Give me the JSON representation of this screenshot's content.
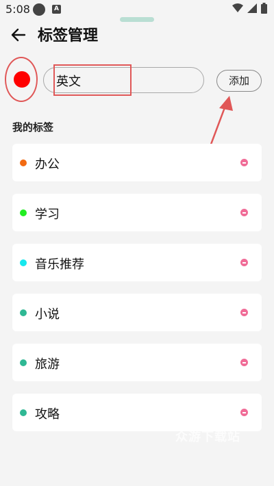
{
  "status_bar": {
    "time": "5:08",
    "badge": "A"
  },
  "header": {
    "title": "标签管理",
    "back_icon": "back-arrow-icon"
  },
  "color_picker": {
    "selected_color": "#ff0000"
  },
  "tag_input": {
    "value": "英文"
  },
  "add_button": {
    "label": "添加"
  },
  "section": {
    "title": "我的标签"
  },
  "tags": [
    {
      "label": "办公",
      "color": "#f26a12"
    },
    {
      "label": "学习",
      "color": "#22ee22"
    },
    {
      "label": "音乐推荐",
      "color": "#16e8ee"
    },
    {
      "label": "小说",
      "color": "#2fb894"
    },
    {
      "label": "旅游",
      "color": "#2fb894"
    },
    {
      "label": "攻略",
      "color": "#2fb894"
    }
  ],
  "watermark": {
    "text": "众游下载站"
  },
  "colors": {
    "annotation": "#e05757",
    "remove": "#f06c97",
    "accent": "#b9ded3"
  }
}
